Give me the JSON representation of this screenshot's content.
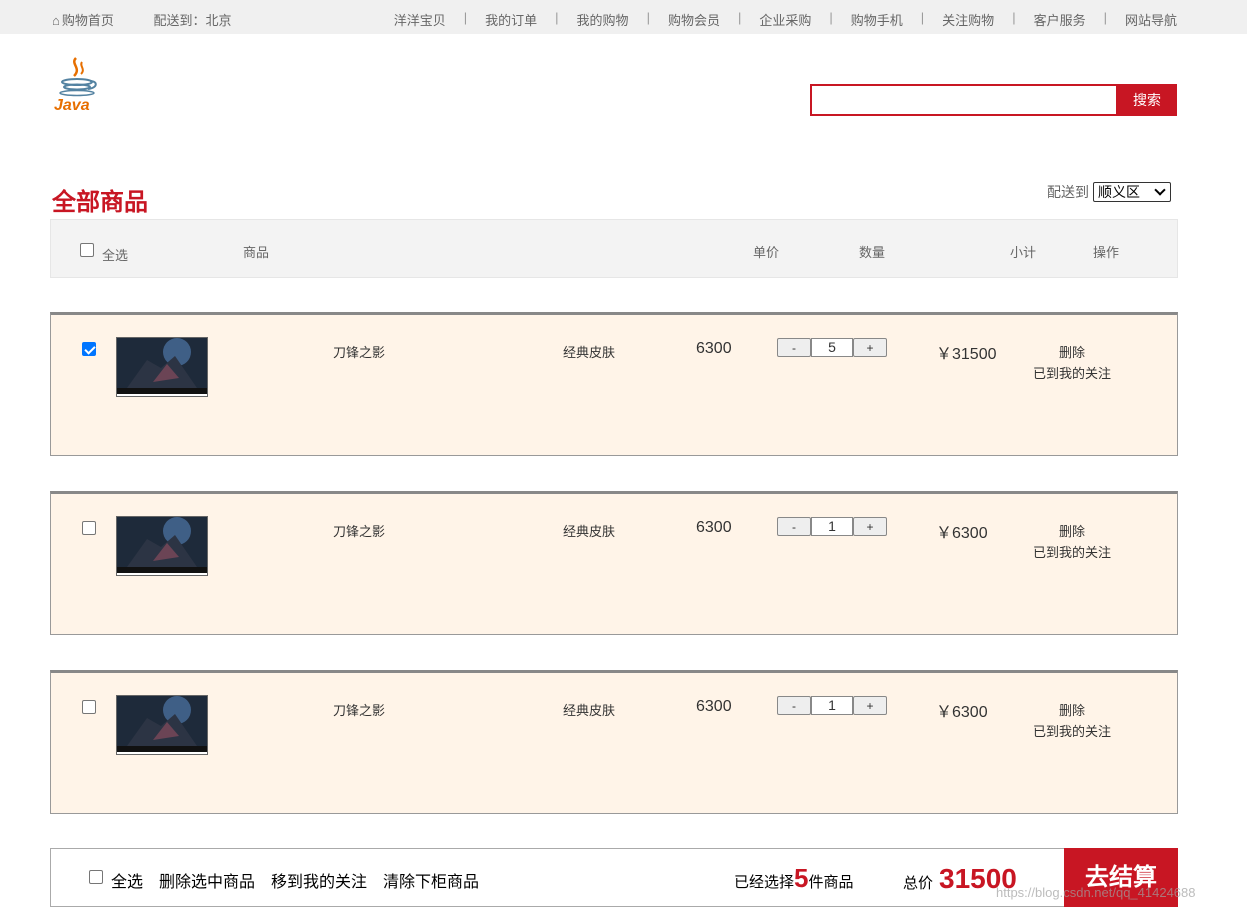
{
  "topbar": {
    "home": "购物首页",
    "deliver_to": "配送到：北京",
    "nav": [
      "洋洋宝贝",
      "我的订单",
      "我的购物",
      "购物会员",
      "企业采购",
      "购物手机",
      "关注购物",
      "客户服务",
      "网站导航"
    ]
  },
  "logo": {
    "text": "Java"
  },
  "search": {
    "button": "搜索",
    "value": ""
  },
  "cart": {
    "title": "全部商品",
    "deliver_label": "配送到",
    "region": "顺义区"
  },
  "table_header": {
    "select_all": "全选",
    "product": "商品",
    "unit_price": "单价",
    "quantity": "数量",
    "subtotal": "小计",
    "operation": "操作"
  },
  "items": [
    {
      "checked": true,
      "name": "刀锋之影",
      "sku": "经典皮肤",
      "price": "6300",
      "qty": "5",
      "subtotal": "￥31500",
      "delete": "删除",
      "follow": "已到我的关注"
    },
    {
      "checked": false,
      "name": "刀锋之影",
      "sku": "经典皮肤",
      "price": "6300",
      "qty": "1",
      "subtotal": "￥6300",
      "delete": "删除",
      "follow": "已到我的关注"
    },
    {
      "checked": false,
      "name": "刀锋之影",
      "sku": "经典皮肤",
      "price": "6300",
      "qty": "1",
      "subtotal": "￥6300",
      "delete": "删除",
      "follow": "已到我的关注"
    }
  ],
  "qty_controls": {
    "minus": "-",
    "plus": "+"
  },
  "footer": {
    "select_all": "全选",
    "delete_selected": "删除选中商品",
    "move_to_follow": "移到我的关注",
    "clear_removed": "清除下柜商品",
    "selected_prefix": "已经选择",
    "selected_count": "5",
    "selected_suffix": "件商品",
    "total_label": "总价",
    "total_value": "31500",
    "checkout": "去结算"
  },
  "watermark": "https://blog.csdn.net/qq_41424688",
  "colors": {
    "accent": "#c81623",
    "row_bg": "#fff4e8",
    "header_bg": "#f3f3f3"
  }
}
